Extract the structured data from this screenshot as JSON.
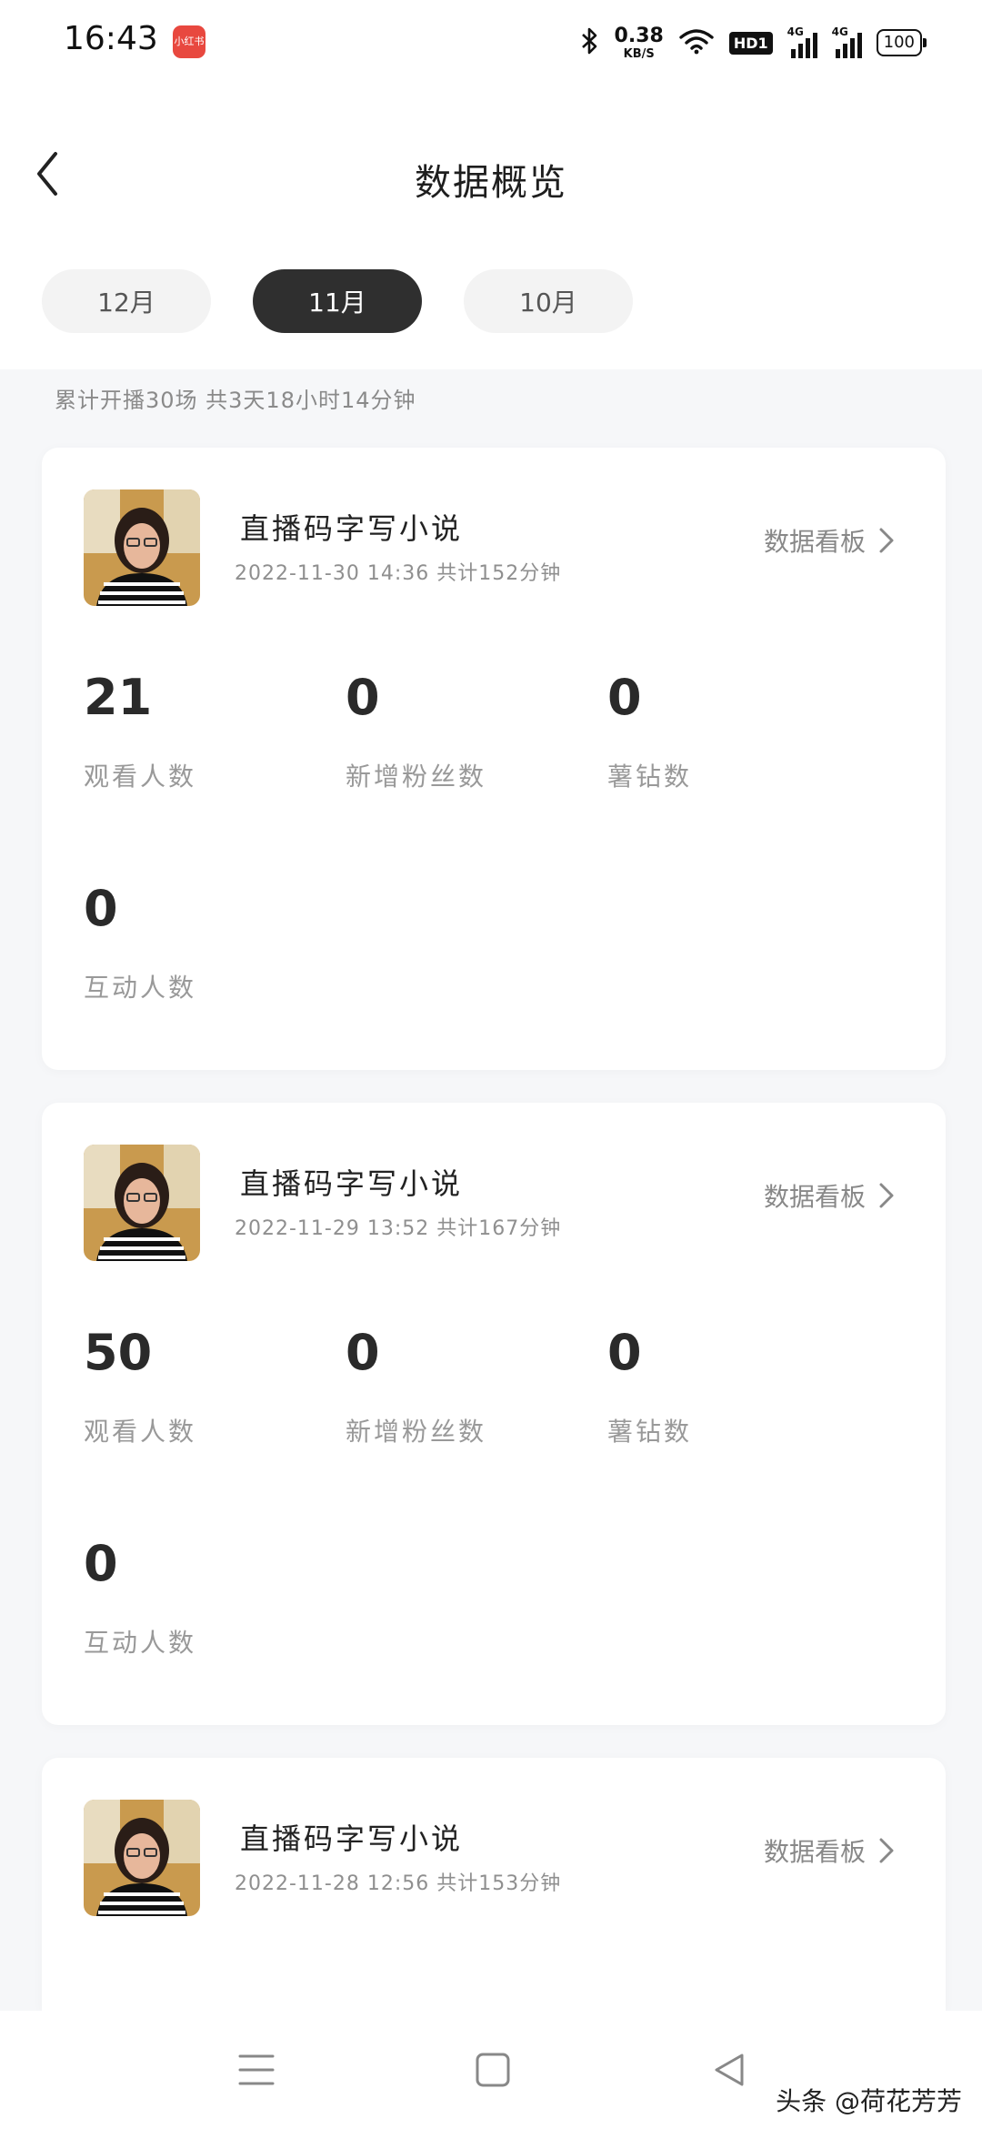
{
  "status_bar": {
    "time": "16:43",
    "app_icon": "小红书-app-icon",
    "network_speed_value": "0.38",
    "network_speed_unit": "KB/S",
    "hd_label": "HD1",
    "signal_label_1": "4G",
    "signal_label_2": "4G",
    "battery": "100"
  },
  "header": {
    "title": "数据概览",
    "back_icon": "chevron-left-icon"
  },
  "tabs": [
    {
      "label": "12月",
      "active": false
    },
    {
      "label": "11月",
      "active": true
    },
    {
      "label": "10月",
      "active": false
    }
  ],
  "summary": "累计开播30场 共3天18小时14分钟",
  "sessions": [
    {
      "title": "直播码字写小说",
      "meta": "2022-11-30 14:36 共计152分钟",
      "dashboard_label": "数据看板",
      "stats": [
        {
          "value": "21",
          "label": "观看人数"
        },
        {
          "value": "0",
          "label": "新增粉丝数"
        },
        {
          "value": "0",
          "label": "薯钻数"
        },
        {
          "value": "0",
          "label": "互动人数"
        }
      ]
    },
    {
      "title": "直播码字写小说",
      "meta": "2022-11-29 13:52 共计167分钟",
      "dashboard_label": "数据看板",
      "stats": [
        {
          "value": "50",
          "label": "观看人数"
        },
        {
          "value": "0",
          "label": "新增粉丝数"
        },
        {
          "value": "0",
          "label": "薯钻数"
        },
        {
          "value": "0",
          "label": "互动人数"
        }
      ]
    },
    {
      "title": "直播码字写小说",
      "meta": "2022-11-28 12:56 共计153分钟",
      "dashboard_label": "数据看板",
      "stats": []
    }
  ],
  "nav_bar": {
    "menu_icon": "menu-icon",
    "home_icon": "square-home-icon",
    "back_icon": "triangle-back-icon"
  },
  "watermark": "头条 @荷花芳芳"
}
